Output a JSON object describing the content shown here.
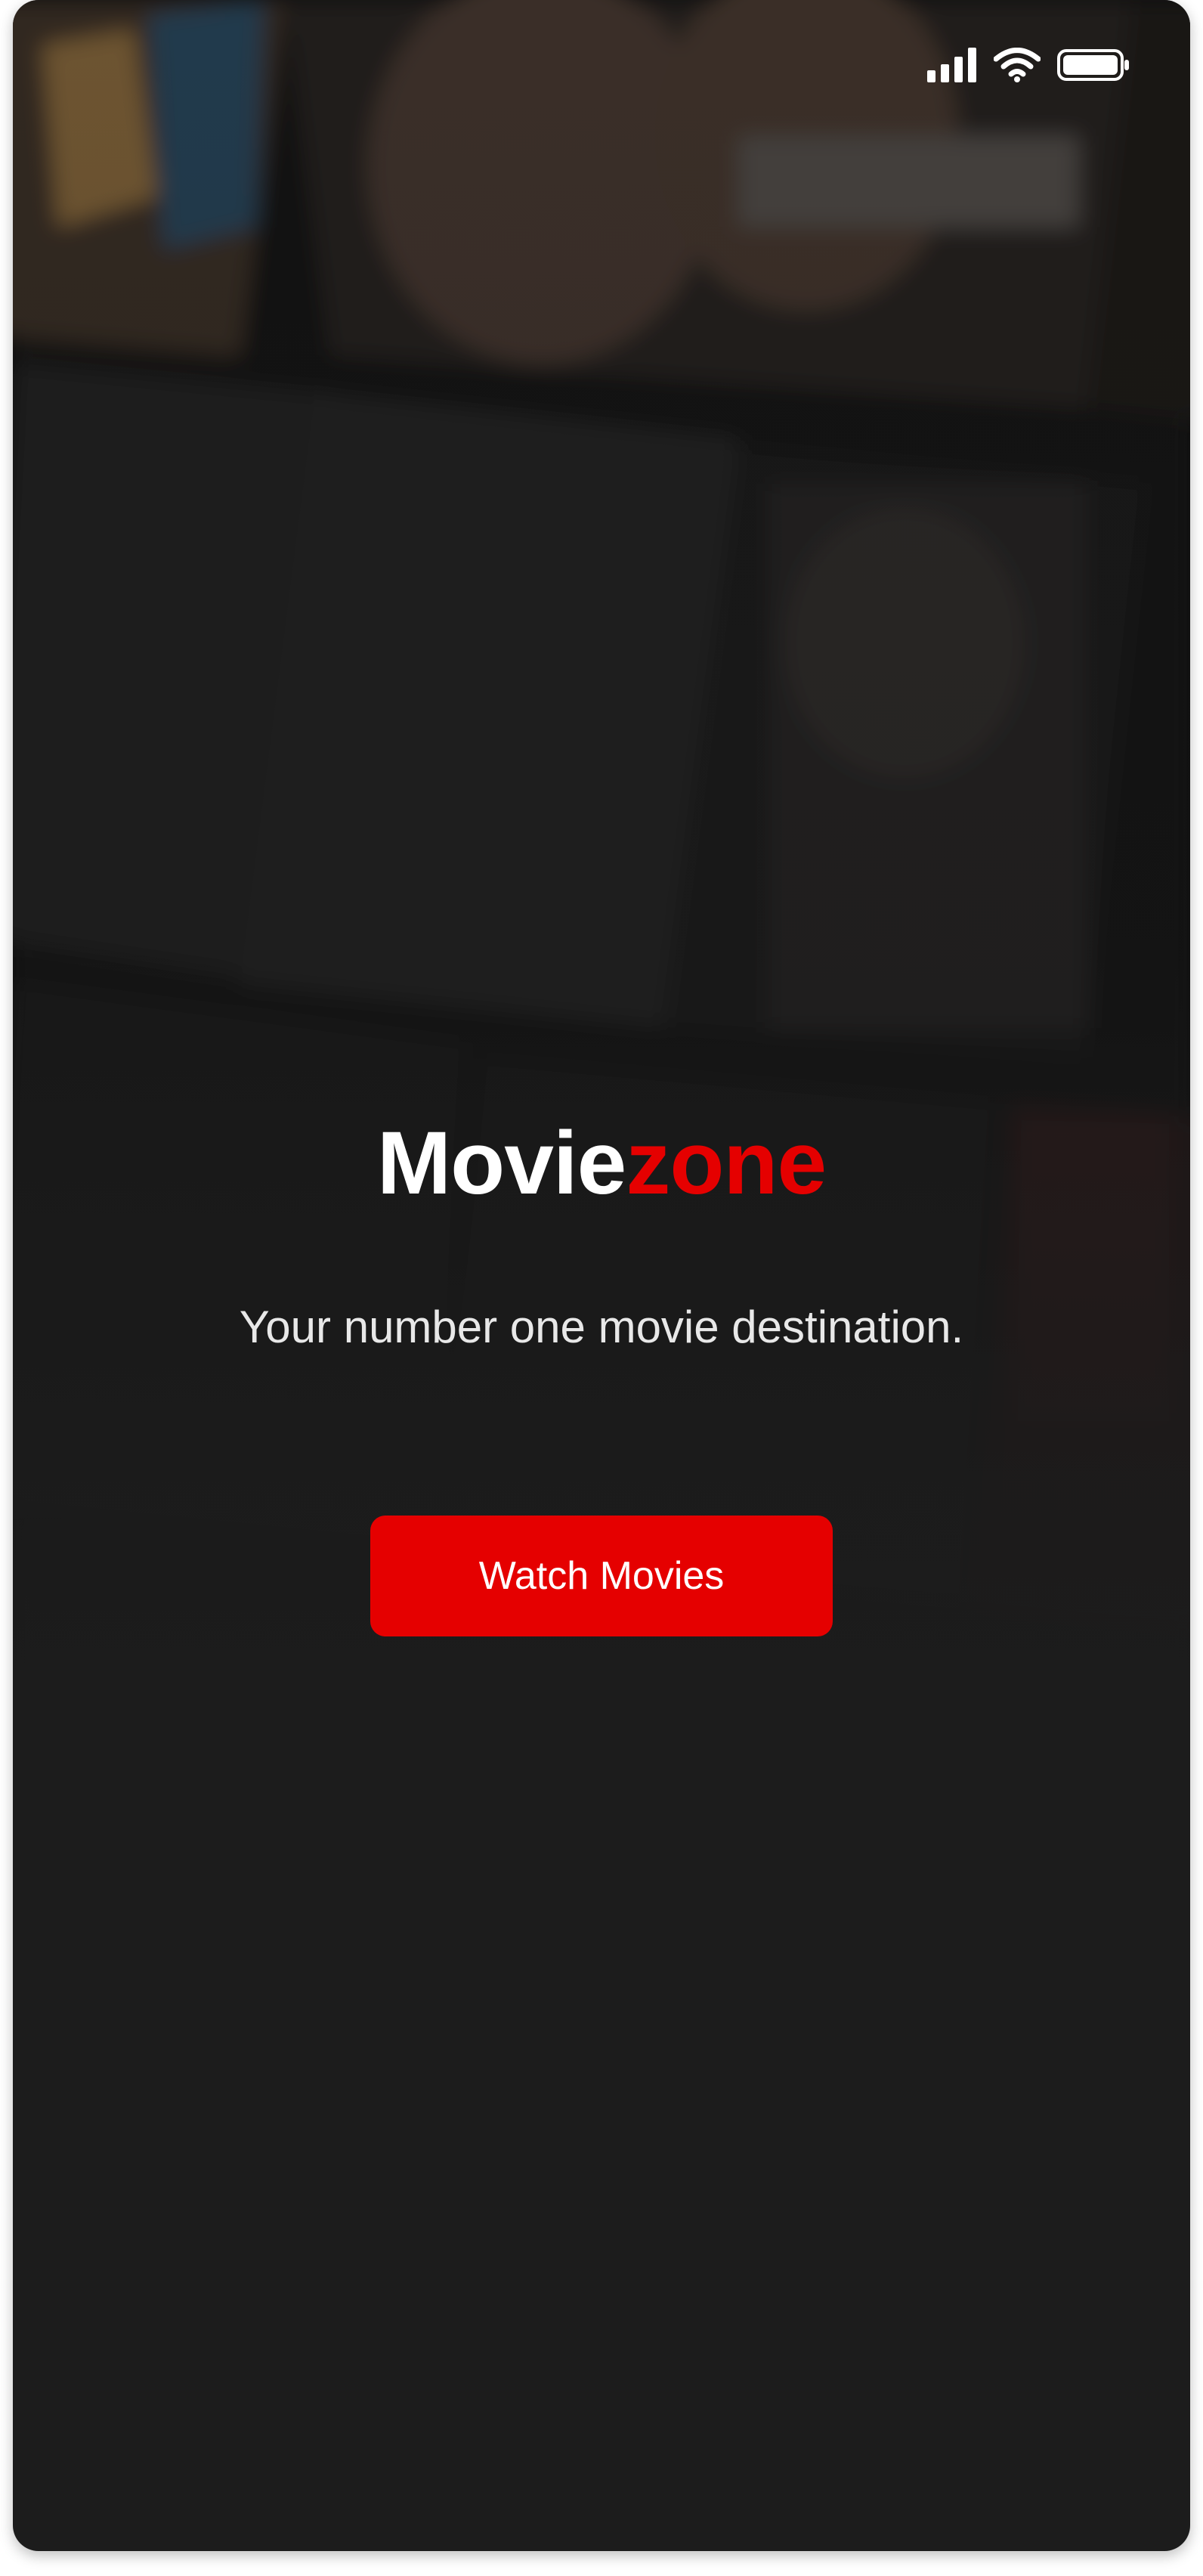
{
  "app": {
    "brand_part1": "Movie",
    "brand_part2": "zone",
    "tagline": "Your number one movie destination.",
    "cta_label": "Watch Movies"
  },
  "status_bar": {
    "icons": [
      "cellular-signal-icon",
      "wifi-icon",
      "battery-icon"
    ]
  },
  "background": {
    "description_icon": "movie-poster-collage"
  },
  "colors": {
    "accent": "#e50000",
    "background": "#1c1c1c",
    "text": "#ffffff"
  }
}
